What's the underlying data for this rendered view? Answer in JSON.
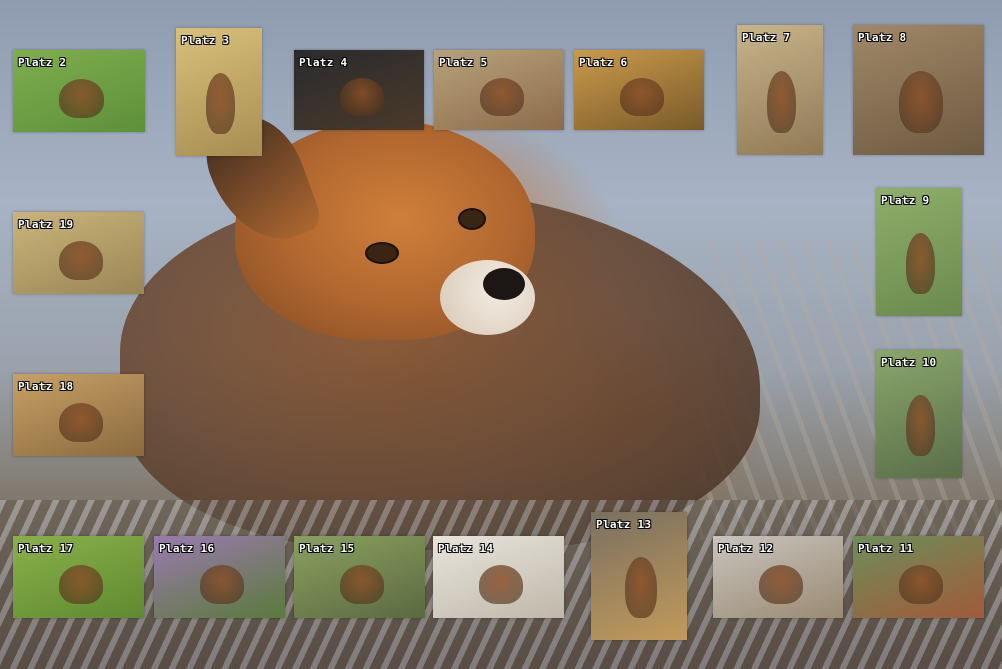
{
  "scene": {
    "subject": "Red fox lying in frosted reeds",
    "colors": {
      "fox_fur": "#b1672f",
      "background": "#a7b3c4",
      "label_text": "#ffffff",
      "label_outline": "#000000"
    }
  },
  "tiles": [
    {
      "id": "platz-2",
      "label": "Platz 2",
      "photo": "deer-on-grass",
      "tint": [
        "#7fae4f",
        "#5e8f3a"
      ]
    },
    {
      "id": "platz-3",
      "label": "Platz 3",
      "photo": "cheetah-cub-on-tree",
      "tint": [
        "#d8c07a",
        "#a88d52"
      ]
    },
    {
      "id": "platz-4",
      "label": "Platz 4",
      "photo": "fox-silhouette-dark",
      "tint": [
        "#2a2a2e",
        "#4a3a2a"
      ]
    },
    {
      "id": "platz-5",
      "label": "Platz 5",
      "photo": "squirrel-on-log",
      "tint": [
        "#b7a27a",
        "#8d6b4a"
      ]
    },
    {
      "id": "platz-6",
      "label": "Platz 6",
      "photo": "deer-silhouette-sunset",
      "tint": [
        "#c99a4a",
        "#7a5a2a"
      ]
    },
    {
      "id": "platz-7",
      "label": "Platz 7",
      "photo": "deer-head-in-grass",
      "tint": [
        "#c7b48a",
        "#8f7a55"
      ]
    },
    {
      "id": "platz-8",
      "label": "Platz 8",
      "photo": "hare-portrait",
      "tint": [
        "#a08867",
        "#6e5a42"
      ]
    },
    {
      "id": "platz-9",
      "label": "Platz 9",
      "photo": "hare-in-meadow",
      "tint": [
        "#8fae6a",
        "#6a8a4e"
      ]
    },
    {
      "id": "platz-10",
      "label": "Platz 10",
      "photo": "vole-standing",
      "tint": [
        "#8aa66a",
        "#5a6e4a"
      ]
    },
    {
      "id": "platz-11",
      "label": "Platz 11",
      "photo": "squirrels-in-flowers",
      "tint": [
        "#6e8e5a",
        "#a05a3a"
      ]
    },
    {
      "id": "platz-12",
      "label": "Platz 12",
      "photo": "goat-on-snow",
      "tint": [
        "#c8c4be",
        "#9a8a72"
      ]
    },
    {
      "id": "platz-13",
      "label": "Platz 13",
      "photo": "lion-cub",
      "tint": [
        "#7a7060",
        "#c29a5a"
      ]
    },
    {
      "id": "platz-14",
      "label": "Platz 14",
      "photo": "seal-pup",
      "tint": [
        "#e8e4dc",
        "#bfb8aa"
      ]
    },
    {
      "id": "platz-15",
      "label": "Platz 15",
      "photo": "squirrel-on-moss",
      "tint": [
        "#8aa060",
        "#5a6a40"
      ]
    },
    {
      "id": "platz-16",
      "label": "Platz 16",
      "photo": "bird-in-crocuses",
      "tint": [
        "#9a7ab0",
        "#5a7a3a"
      ]
    },
    {
      "id": "platz-17",
      "label": "Platz 17",
      "photo": "hare-in-green-grass",
      "tint": [
        "#8ab04a",
        "#5e8a30"
      ]
    },
    {
      "id": "platz-18",
      "label": "Platz 18",
      "photo": "hare-in-dry-grass",
      "tint": [
        "#c8a066",
        "#8a6a3e"
      ]
    },
    {
      "id": "platz-19",
      "label": "Platz 19",
      "photo": "bird-in-dry-field",
      "tint": [
        "#cbb47a",
        "#9a8656"
      ]
    }
  ]
}
